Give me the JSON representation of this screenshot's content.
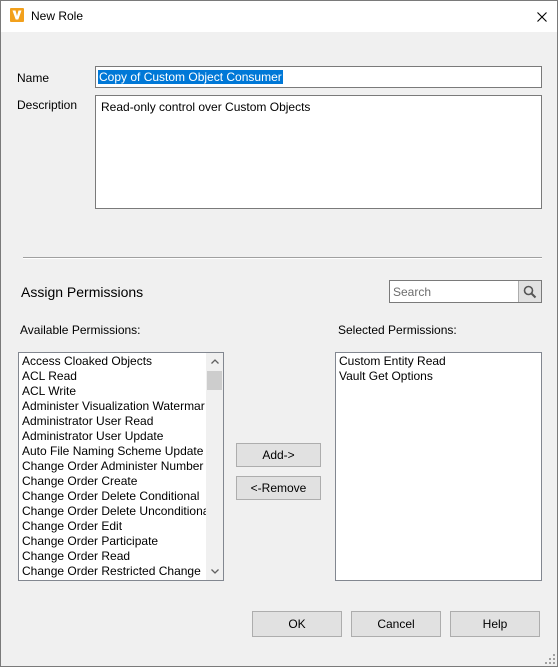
{
  "window": {
    "title": "New Role",
    "app_icon": "autodesk-vault-icon",
    "close_icon": "close-icon"
  },
  "form": {
    "name_label": "Name",
    "name_value": "Copy of Custom Object Consumer",
    "description_label": "Description",
    "description_value": "Read-only control over Custom Objects"
  },
  "permissions": {
    "section_title": "Assign Permissions",
    "search_placeholder": "Search",
    "search_icon": "magnifier-icon",
    "available_label": "Available Permissions:",
    "selected_label": "Selected Permissions:",
    "available": [
      "Access Cloaked Objects",
      "ACL Read",
      "ACL Write",
      "Administer Visualization Watermar",
      "Administrator User Read",
      "Administrator User Update",
      "Auto File Naming Scheme Update",
      "Change Order Administer Number",
      "Change Order Create",
      "Change Order Delete Conditional",
      "Change Order Delete Unconditiona",
      "Change Order Edit",
      "Change Order Participate",
      "Change Order Read",
      "Change Order Restricted Change"
    ],
    "selected": [
      "Custom Entity Read",
      "Vault Get Options"
    ],
    "add_label": "Add->",
    "remove_label": "<-Remove"
  },
  "footer": {
    "ok_label": "OK",
    "cancel_label": "Cancel",
    "help_label": "Help"
  }
}
